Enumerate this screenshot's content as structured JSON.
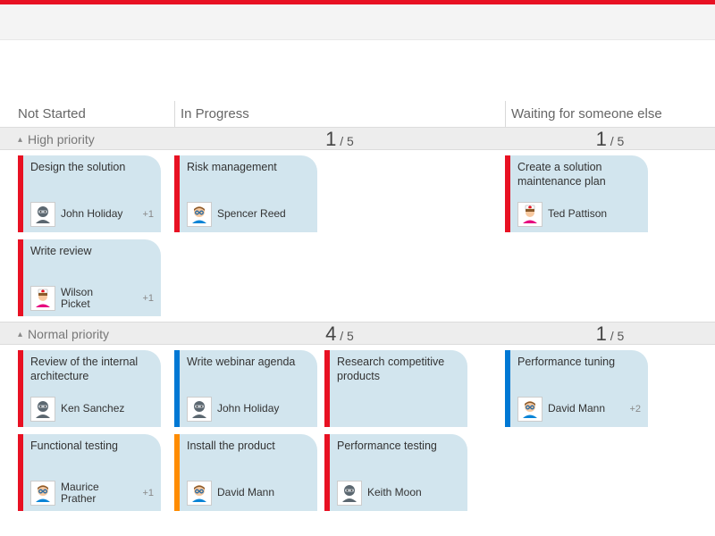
{
  "columns": [
    "Not Started",
    "In Progress",
    "Waiting for someone else"
  ],
  "avatars": {
    "ninja": {
      "body": "#5b6770",
      "face": "#c7cdd2"
    },
    "male": {
      "body": "#0a84d6",
      "face": "#f7c9a0",
      "hair": "#8a5a2b",
      "glasses": true
    },
    "nurse": {
      "body": "#e6007e",
      "face": "#f7c9a0",
      "hat": true
    },
    "blonde": {
      "body": "#0a84d6",
      "face": "#f7c9a0",
      "hair": "#e7b84a"
    }
  },
  "lanes": [
    {
      "title": "High priority",
      "counts": {
        "col1": null,
        "col2": {
          "n": 1,
          "d": 5
        },
        "col3": {
          "n": 1,
          "d": 5
        }
      },
      "cards": {
        "col1": [
          {
            "title": "Design the solution",
            "color": "red",
            "assignee": "John Holiday",
            "avatar": "ninja",
            "extra": "+1"
          },
          {
            "title": "Write review",
            "color": "red",
            "assignee": "Wilson Picket",
            "avatar": "nurse",
            "extra": "+1"
          }
        ],
        "col2": [
          {
            "title": "Risk management",
            "color": "red",
            "assignee": "Spencer Reed",
            "avatar": "male"
          }
        ],
        "col3": [
          {
            "title": "Create a solution maintenance plan",
            "color": "red",
            "assignee": "Ted Pattison",
            "avatar": "nurse"
          }
        ]
      }
    },
    {
      "title": "Normal priority",
      "counts": {
        "col1": null,
        "col2": {
          "n": 4,
          "d": 5
        },
        "col3": {
          "n": 1,
          "d": 5
        }
      },
      "cards": {
        "col1": [
          {
            "title": "Review of the internal architecture",
            "color": "red",
            "assignee": "Ken Sanchez",
            "avatar": "ninja"
          },
          {
            "title": "Functional testing",
            "color": "red",
            "assignee": "Maurice Prather",
            "avatar": "male",
            "extra": "+1"
          }
        ],
        "col2": [
          {
            "title": "Write webinar agenda",
            "color": "blue",
            "assignee": "John Holiday",
            "avatar": "ninja"
          },
          {
            "title": "Research competitive products",
            "color": "red",
            "assignee": "",
            "avatar": null
          },
          {
            "title": "Install the product",
            "color": "orange",
            "assignee": "David Mann",
            "avatar": "male"
          },
          {
            "title": "Performance testing",
            "color": "red",
            "assignee": "Keith Moon",
            "avatar": "ninja"
          }
        ],
        "col3": [
          {
            "title": "Performance tuning",
            "color": "blue",
            "assignee": "David Mann",
            "avatar": "male",
            "extra": "+2"
          }
        ]
      }
    }
  ]
}
